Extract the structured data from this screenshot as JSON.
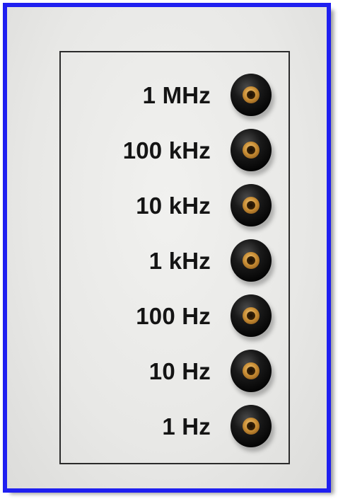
{
  "panel": {
    "outputs": [
      {
        "label": "1 MHz"
      },
      {
        "label": "100 kHz"
      },
      {
        "label": "10 kHz"
      },
      {
        "label": "1 kHz"
      },
      {
        "label": "100 Hz"
      },
      {
        "label": "10 Hz"
      },
      {
        "label": "1 Hz"
      }
    ]
  },
  "colors": {
    "frame_border": "#1f1ff0",
    "panel_background": "#e8e8e6",
    "label_text": "#141414",
    "jack_body": "#0a0a0a",
    "jack_contact": "#c98e35"
  },
  "icons": {
    "jack": "banana-socket-icon"
  }
}
